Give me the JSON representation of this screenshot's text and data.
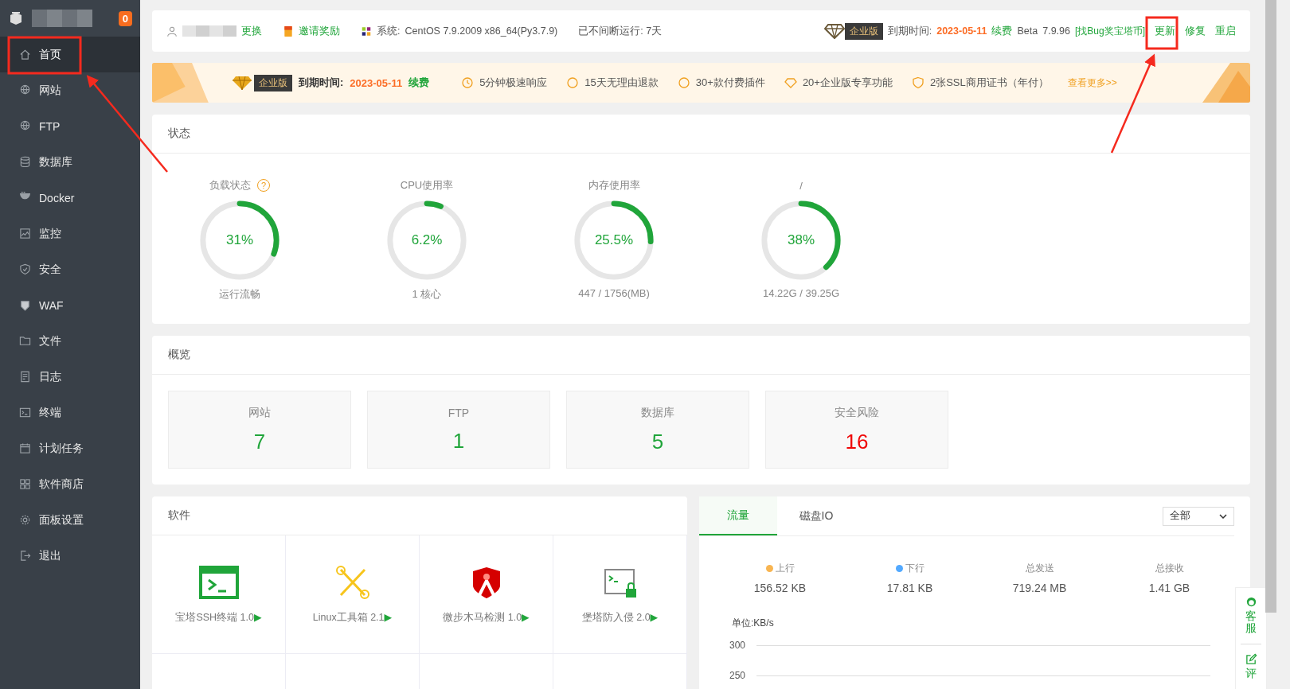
{
  "sidebar": {
    "badge": "0",
    "items": [
      {
        "label": "首页",
        "selected": true
      },
      {
        "label": "网站",
        "selected": false
      },
      {
        "label": "FTP",
        "selected": false
      },
      {
        "label": "数据库",
        "selected": false
      },
      {
        "label": "Docker",
        "selected": false
      },
      {
        "label": "监控",
        "selected": false
      },
      {
        "label": "安全",
        "selected": false
      },
      {
        "label": "WAF",
        "selected": false
      },
      {
        "label": "文件",
        "selected": false
      },
      {
        "label": "日志",
        "selected": false
      },
      {
        "label": "终端",
        "selected": false
      },
      {
        "label": "计划任务",
        "selected": false
      },
      {
        "label": "软件商店",
        "selected": false
      },
      {
        "label": "面板设置",
        "selected": false
      },
      {
        "label": "退出",
        "selected": false
      }
    ]
  },
  "topbar": {
    "change_link": "更换",
    "invite": "邀请奖励",
    "system_label": "系统:",
    "system": "CentOS 7.9.2009 x86_64(Py3.7.9)",
    "uptime": "已不间断运行: 7天",
    "edition": "企业版",
    "expiry_label": "到期时间:",
    "expiry": "2023-05-11",
    "renew": "续费",
    "channel": "Beta",
    "version": "7.9.96",
    "bug_link": "[找Bug奖宝塔币]",
    "actions": [
      "更新",
      "修复",
      "重启"
    ]
  },
  "banner": {
    "edition": "企业版",
    "expiry_label": "到期时间:",
    "expiry": "2023-05-11",
    "renew": "续费",
    "features": [
      "5分钟极速响应",
      "15天无理由退款",
      "30+款付费插件",
      "20+企业版专享功能",
      "2张SSL商用证书（年付）"
    ],
    "more": "查看更多>>"
  },
  "status": {
    "title": "状态",
    "gauges": [
      {
        "label": "负载状态",
        "help": "?",
        "level": 0.31,
        "value": "31%",
        "caption": "运行流畅"
      },
      {
        "label": "CPU使用率",
        "level": 0.062,
        "value": "6.2%",
        "caption": "1 核心"
      },
      {
        "label": "内存使用率",
        "level": 0.255,
        "value": "25.5%",
        "caption": "447 / 1756(MB)"
      },
      {
        "label": "/",
        "level": 0.38,
        "value": "38%",
        "caption": "14.22G / 39.25G"
      }
    ]
  },
  "overview": {
    "title": "概览",
    "items": [
      {
        "label": "网站",
        "count": "7",
        "alert": false
      },
      {
        "label": "FTP",
        "count": "1",
        "alert": false
      },
      {
        "label": "数据库",
        "count": "5",
        "alert": false
      },
      {
        "label": "安全风险",
        "count": "16",
        "alert": true
      }
    ]
  },
  "software": {
    "title": "软件",
    "items": [
      {
        "name": "宝塔SSH终端 1.0",
        "marker": "▶"
      },
      {
        "name": "Linux工具箱 2.1",
        "marker": "▶"
      },
      {
        "name": "微步木马检测 1.0",
        "marker": "▶"
      },
      {
        "name": "堡塔防入侵 2.0",
        "marker": "▶"
      }
    ]
  },
  "traffic": {
    "tabs": [
      {
        "label": "流量",
        "selected": true
      },
      {
        "label": "磁盘IO",
        "selected": false
      }
    ],
    "filter": "全部",
    "stats": [
      {
        "label": "上行",
        "value": "156.52 KB",
        "color": "#f8b551"
      },
      {
        "label": "下行",
        "value": "17.81 KB",
        "color": "#52a9ff"
      },
      {
        "label": "总发送",
        "value": "719.24 MB"
      },
      {
        "label": "总接收",
        "value": "1.41 GB"
      }
    ],
    "unit": "单位:KB/s",
    "gridlines": [
      "300",
      "250"
    ]
  },
  "support": {
    "label": "客服",
    "review": "评"
  }
}
